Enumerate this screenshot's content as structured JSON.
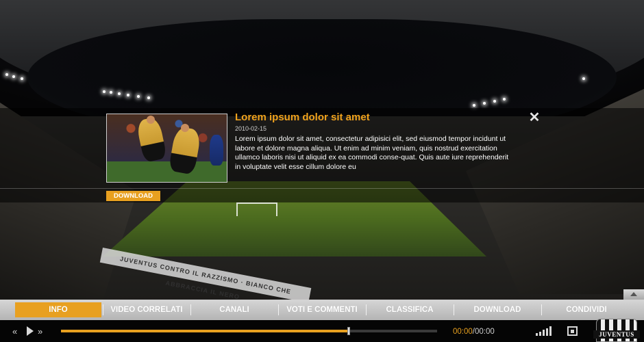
{
  "article": {
    "title": "Lorem ipsum dolor sit amet",
    "date": "2010-02-15",
    "body": "Lorem ipsum dolor sit amet, consectetur adipisici elit, sed eiusmod tempor incidunt ut labore et dolore magna aliqua. Ut enim ad minim veniam, quis nostrud exercitation ullamco laboris nisi ut aliquid ex ea commodi conse-quat. Quis aute iure reprehenderit in voluptate velit esse cillum dolore eu",
    "download_label": "DOWNLOAD",
    "close_label": "✕"
  },
  "background": {
    "banner_text": "JUVENTUS CONTRO IL RAZZISMO · BIANCO CHE ABBRACCIA IL NERO"
  },
  "tabs": [
    {
      "label": "INFO",
      "active": true
    },
    {
      "label": "VIDEO CORRELATI",
      "active": false
    },
    {
      "label": "CANALI",
      "active": false
    },
    {
      "label": "VOTI E COMMENTI",
      "active": false
    },
    {
      "label": "CLASSIFICA",
      "active": false
    },
    {
      "label": "DOWNLOAD",
      "active": false
    },
    {
      "label": "CONDIVIDI",
      "active": false
    }
  ],
  "player": {
    "rewind_icon": "«",
    "forward_icon": "»",
    "progress_fraction": 0.765,
    "current_time": "00:00",
    "time_separator": "/",
    "total_time": "00:00"
  },
  "logo": {
    "text": "JUVENTUS"
  },
  "colors": {
    "accent": "#e8a020",
    "title": "#f0a21c"
  }
}
